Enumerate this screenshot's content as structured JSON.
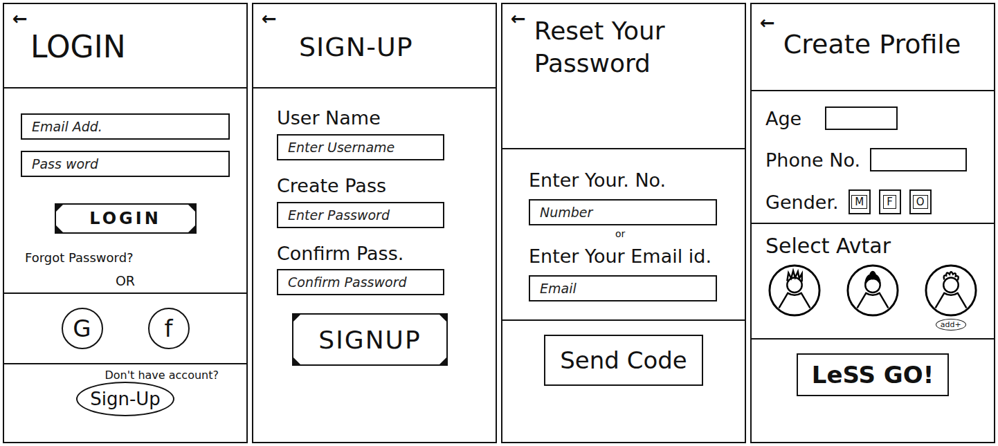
{
  "login": {
    "back": "←",
    "title": "LOGIN",
    "fields": [
      "Email Add.",
      "Pass word"
    ],
    "button": "LOGIN",
    "forgot": "Forgot Password?",
    "or": "OR",
    "social": [
      "G",
      "f"
    ],
    "prompt": "Don't have account?",
    "signup": "Sign-Up"
  },
  "signup": {
    "back": "←",
    "title": "SIGN-UP",
    "fields": [
      {
        "label": "User Name",
        "placeholder": "Enter Username"
      },
      {
        "label": "Create Pass",
        "placeholder": "Enter Password"
      },
      {
        "label": "Confirm Pass.",
        "placeholder": "Confirm Password"
      }
    ],
    "button": "SIGNUP"
  },
  "reset": {
    "back": "←",
    "title": "Reset Your Password",
    "number_label": "Enter Your. No.",
    "number_placeholder": "Number",
    "or": "or",
    "email_label": "Enter Your Email id.",
    "email_placeholder": "Email",
    "button": "Send Code"
  },
  "profile": {
    "back": "←",
    "title": "Create Profile",
    "age": "Age",
    "phone": "Phone No.",
    "gender": "Gender.",
    "genders": [
      {
        "label": "M",
        "selected": false
      },
      {
        "label": "F",
        "selected": false
      },
      {
        "label": "O",
        "selected": false
      }
    ],
    "avatar_label": "Select Avtar",
    "avatars": [
      {
        "selected": false,
        "badge": ""
      },
      {
        "selected": false,
        "badge": ""
      },
      {
        "selected": false,
        "badge": "add+"
      }
    ],
    "button": "LeSS GO!"
  }
}
